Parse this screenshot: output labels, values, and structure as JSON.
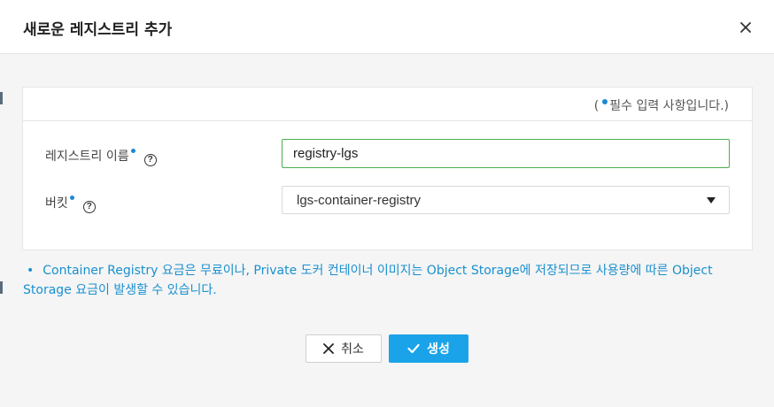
{
  "dialog": {
    "title": "새로운 레지스트리 추가",
    "close_icon": "close-icon"
  },
  "form": {
    "required_note_prefix": "(",
    "required_note_suffix": "필수 입력 사항입니다.)",
    "fields": {
      "name": {
        "label": "레지스트리 이름",
        "value": "registry-lgs",
        "required": true
      },
      "bucket": {
        "label": "버킷",
        "selected": "lgs-container-registry",
        "required": true
      }
    },
    "help_icon_glyph": "?"
  },
  "notice": {
    "bullet": "•",
    "text": "Container Registry 요금은 무료이나, Private 도커 컨테이너 이미지는 Object Storage에 저장되므로 사용량에 따른 Object Storage 요금이 발생할 수 있습니다."
  },
  "buttons": {
    "cancel_label": "취소",
    "create_label": "생성"
  },
  "colors": {
    "accent": "#1aa3e8",
    "notice": "#1a90cf",
    "required_dot": "#1e88d4",
    "active_border": "#4cae4c"
  }
}
